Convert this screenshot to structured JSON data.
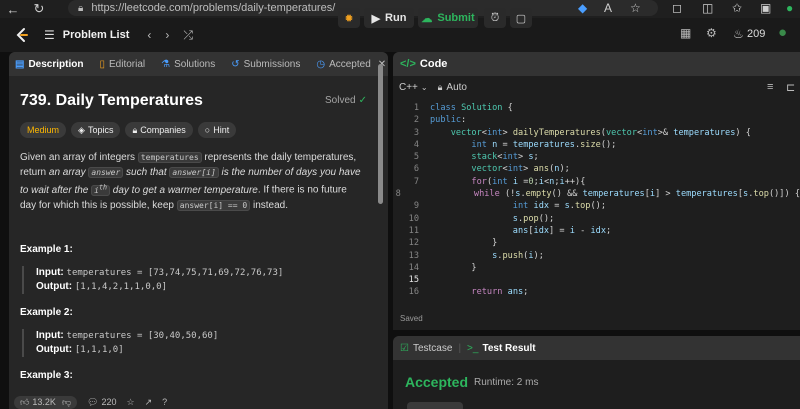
{
  "browser": {
    "url": "https://leetcode.com/problems/daily-temperatures/"
  },
  "header": {
    "problem_list": "Problem List",
    "run_label": "Run",
    "submit_label": "Submit",
    "streak_count": "209"
  },
  "tabs": [
    {
      "label": "Description"
    },
    {
      "label": "Editorial"
    },
    {
      "label": "Solutions"
    },
    {
      "label": "Submissions"
    },
    {
      "label": "Accepted"
    }
  ],
  "problem": {
    "title": "739. Daily Temperatures",
    "status": "Solved",
    "difficulty": "Medium",
    "chips": [
      "Topics",
      "Companies",
      "Hint"
    ],
    "desc": {
      "p1": "Given an array of integers ",
      "c1": "temperatures",
      "p2": " represents the daily temperatures, return ",
      "p3": "an array ",
      "c2": "answer",
      "p4": " such that ",
      "c3": "answer[i]",
      "p5": " is the number of days you have to wait after the ",
      "c4": "i",
      "sup": "th",
      "p6": " day to get a warmer temperature",
      "p7": ". If there is no future day for which this is possible, keep ",
      "c5": "answer[i] == 0",
      "p8": " instead."
    },
    "examples": [
      {
        "title": "Example 1:",
        "input_label": "Input:",
        "input": "temperatures = [73,74,75,71,69,72,76,73]",
        "output_label": "Output:",
        "output": "[1,1,4,2,1,1,0,0]"
      },
      {
        "title": "Example 2:",
        "input_label": "Input:",
        "input": "temperatures = [30,40,50,60]",
        "output_label": "Output:",
        "output": "[1,1,1,0]"
      },
      {
        "title": "Example 3:"
      }
    ],
    "likes": "13.2K",
    "comments": "220"
  },
  "editor": {
    "tab_label": "Code",
    "language": "C++",
    "autosave": "Auto",
    "saved_label": "Saved",
    "line_numbers": [
      "1",
      "2",
      "3",
      "4",
      "5",
      "6",
      "7",
      "8",
      "9",
      "10",
      "11",
      "12",
      "13",
      "14",
      "15",
      "16"
    ]
  },
  "test": {
    "tab_testcase": "Testcase",
    "tab_result": "Test Result",
    "result": "Accepted",
    "runtime": "Runtime: 2 ms"
  },
  "colors": {
    "accent_green": "#2db55d",
    "medium_yellow": "#ffb800",
    "background": "#0f0f0f"
  }
}
